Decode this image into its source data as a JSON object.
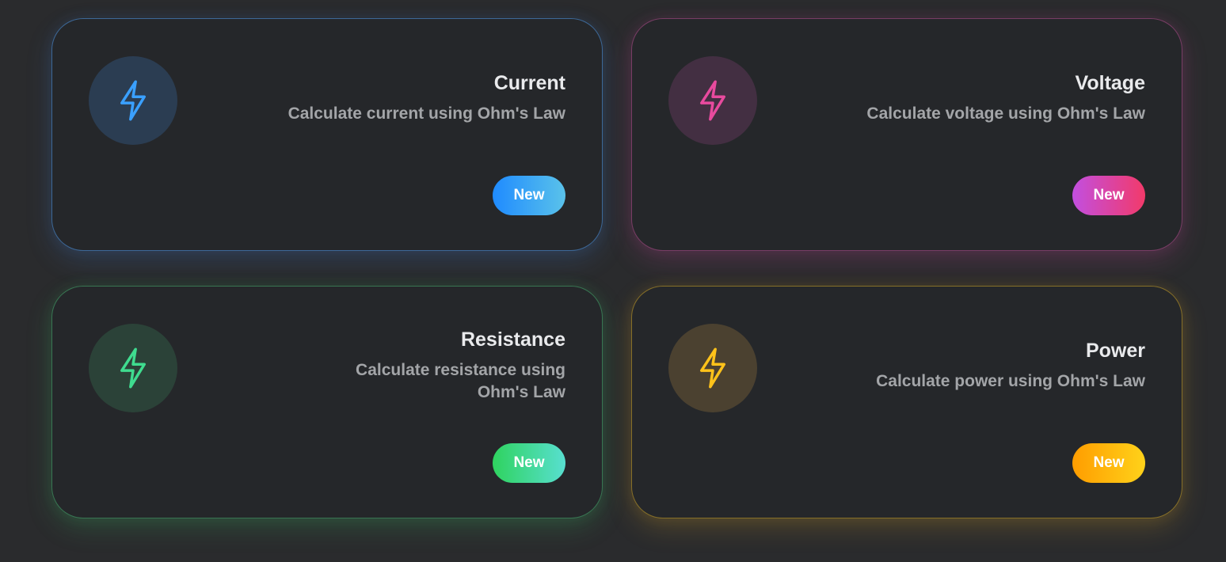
{
  "cards": [
    {
      "title": "Current",
      "description": "Calculate current using Ohm's Law",
      "badge": "New",
      "icon": "lightning-bolt-icon",
      "accent": "#3aa0ff"
    },
    {
      "title": "Voltage",
      "description": "Calculate voltage using Ohm's Law",
      "badge": "New",
      "icon": "lightning-bolt-icon",
      "accent": "#e84a9e"
    },
    {
      "title": "Resistance",
      "description": "Calculate resistance using Ohm's Law",
      "badge": "New",
      "icon": "lightning-bolt-icon",
      "accent": "#3fdc8f"
    },
    {
      "title": "Power",
      "description": "Calculate power using Ohm's Law",
      "badge": "New",
      "icon": "lightning-bolt-icon",
      "accent": "#ffc21a"
    }
  ]
}
